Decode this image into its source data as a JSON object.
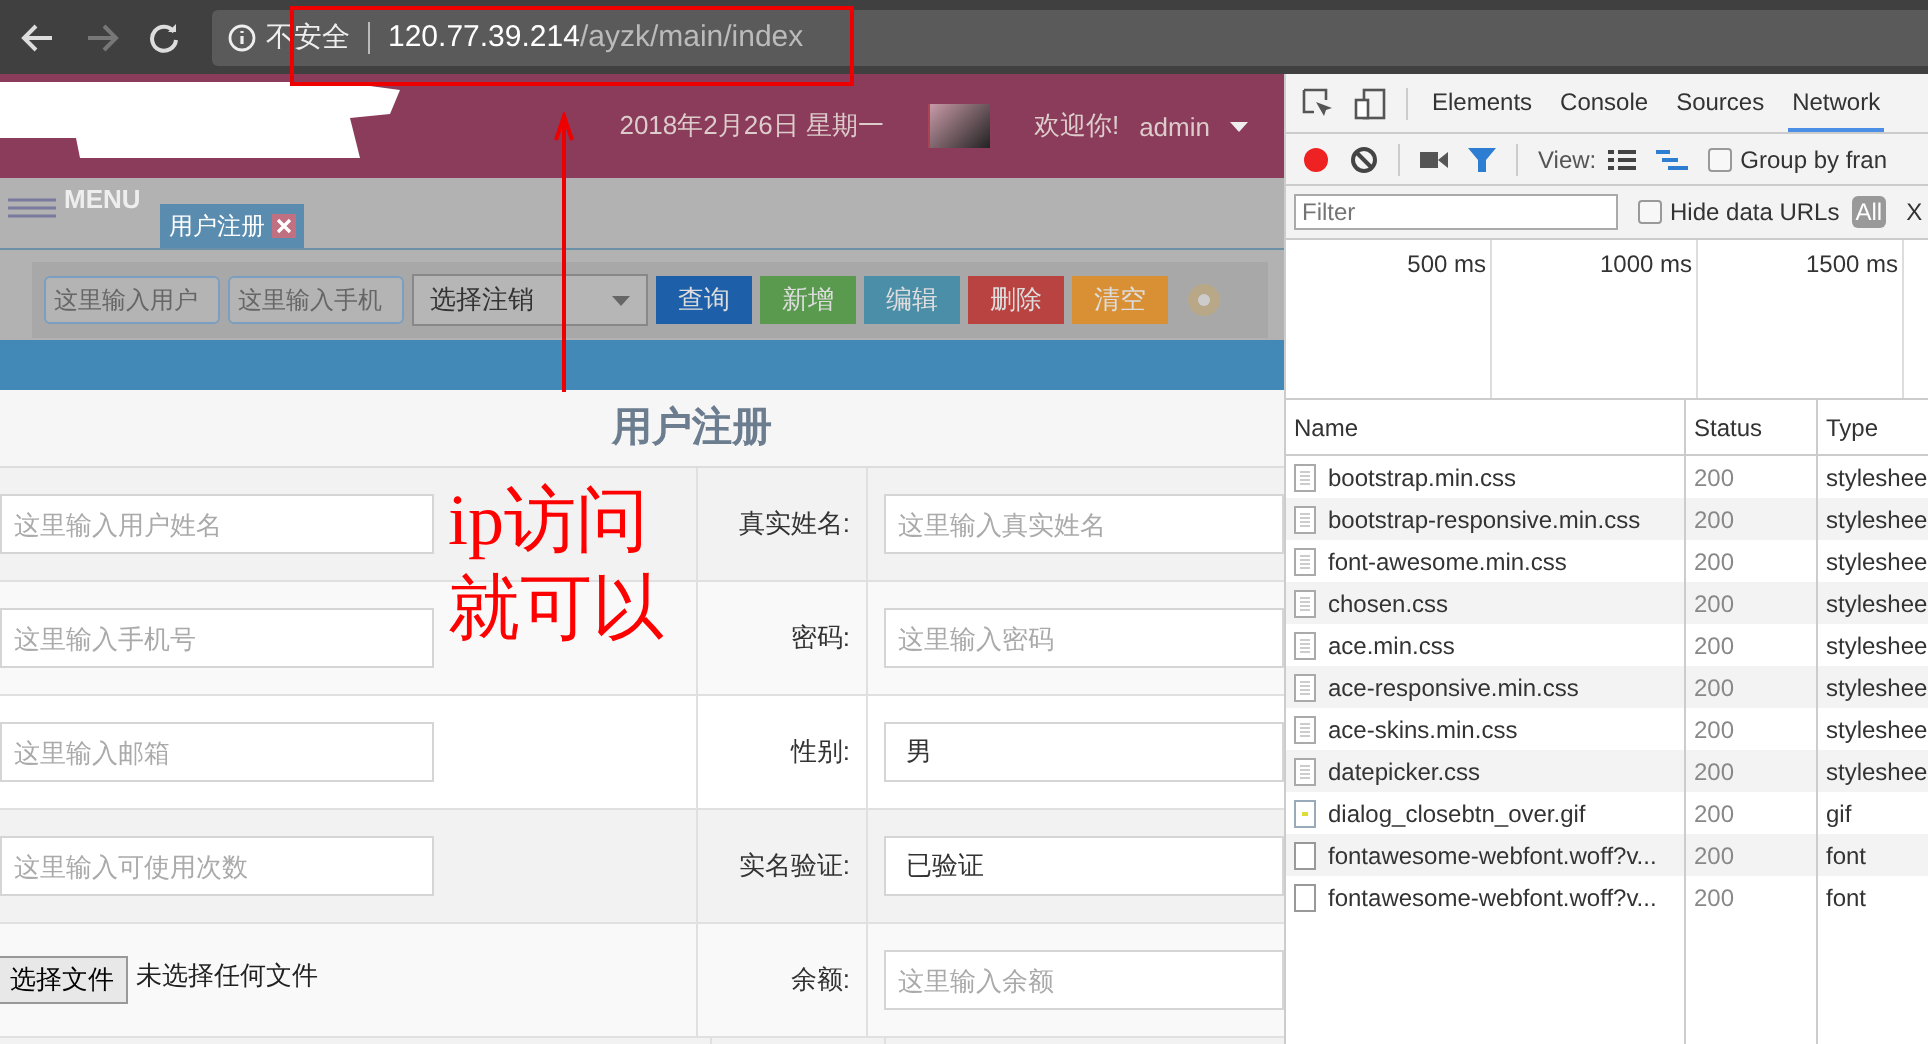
{
  "browser": {
    "security_label": "不安全",
    "url_host": "120.77.39.214",
    "url_path": "/ayzk/main/index"
  },
  "header": {
    "date": "2018年2月26日 星期一",
    "greeting": "欢迎你!",
    "user": "admin"
  },
  "menu_label": "MENU",
  "tabs": [
    {
      "label": "用户注册",
      "selected": true
    }
  ],
  "toolbar": {
    "fields": [
      {
        "placeholder": "这里输入用户"
      },
      {
        "placeholder": "这里输入手机"
      }
    ],
    "select": "选择注销",
    "buttons": [
      {
        "label": "查询",
        "color": "#1d5fa8"
      },
      {
        "label": "新增",
        "color": "#5a9a4f"
      },
      {
        "label": "编辑",
        "color": "#4b8ea8"
      },
      {
        "label": "删除",
        "color": "#b84340"
      },
      {
        "label": "清空",
        "color": "#d99035"
      }
    ]
  },
  "form": {
    "title": "用户注册",
    "rows": [
      {
        "left": {
          "kind": "input",
          "placeholder": "这里输入用户姓名"
        },
        "label": "真实姓名:",
        "right": {
          "kind": "input",
          "placeholder": "这里输入真实姓名"
        }
      },
      {
        "left": {
          "kind": "input",
          "placeholder": "这里输入手机号"
        },
        "label": "密码:",
        "right": {
          "kind": "input",
          "placeholder": "这里输入密码"
        }
      },
      {
        "left": {
          "kind": "input",
          "placeholder": "这里输入邮箱"
        },
        "label": "性别:",
        "right": {
          "kind": "value",
          "value": "男"
        }
      },
      {
        "left": {
          "kind": "input",
          "placeholder": "这里输入可使用次数"
        },
        "label": "实名验证:",
        "right": {
          "kind": "value",
          "value": "已验证"
        }
      },
      {
        "left": {
          "kind": "file",
          "button": "选择文件",
          "status": "未选择任何文件"
        },
        "label": "余额:",
        "right": {
          "kind": "input",
          "placeholder": "这里输入余额"
        }
      }
    ]
  },
  "annotation": {
    "text": "ip访问就可以"
  },
  "devtools": {
    "tabs": [
      {
        "label": "Elements",
        "selected": false
      },
      {
        "label": "Console",
        "selected": false
      },
      {
        "label": "Sources",
        "selected": false
      },
      {
        "label": "Network",
        "selected": true
      }
    ],
    "view_label": "View:",
    "group_by": {
      "label": "Group by fran",
      "checked": false
    },
    "filter_placeholder": "Filter",
    "hide_data_urls": {
      "label": "Hide data URLs",
      "checked": false
    },
    "all_label": "All",
    "x_label": "X",
    "timeline_ticks": [
      "500 ms",
      "1000 ms",
      "1500 ms"
    ],
    "columns": [
      "Name",
      "Status",
      "Type"
    ],
    "rows": [
      {
        "name": "bootstrap.min.css",
        "status": "200",
        "type": "styleshee",
        "kind": "doc"
      },
      {
        "name": "bootstrap-responsive.min.css",
        "status": "200",
        "type": "styleshee",
        "kind": "doc"
      },
      {
        "name": "font-awesome.min.css",
        "status": "200",
        "type": "styleshee",
        "kind": "doc"
      },
      {
        "name": "chosen.css",
        "status": "200",
        "type": "styleshee",
        "kind": "doc"
      },
      {
        "name": "ace.min.css",
        "status": "200",
        "type": "styleshee",
        "kind": "doc"
      },
      {
        "name": "ace-responsive.min.css",
        "status": "200",
        "type": "styleshee",
        "kind": "doc"
      },
      {
        "name": "ace-skins.min.css",
        "status": "200",
        "type": "styleshee",
        "kind": "doc"
      },
      {
        "name": "datepicker.css",
        "status": "200",
        "type": "styleshee",
        "kind": "doc"
      },
      {
        "name": "dialog_closebtn_over.gif",
        "status": "200",
        "type": "gif",
        "kind": "image"
      },
      {
        "name": "fontawesome-webfont.woff?v...",
        "status": "200",
        "type": "font",
        "kind": "blank"
      },
      {
        "name": "fontawesome-webfont.woff?v...",
        "status": "200",
        "type": "font",
        "kind": "blank"
      }
    ]
  }
}
